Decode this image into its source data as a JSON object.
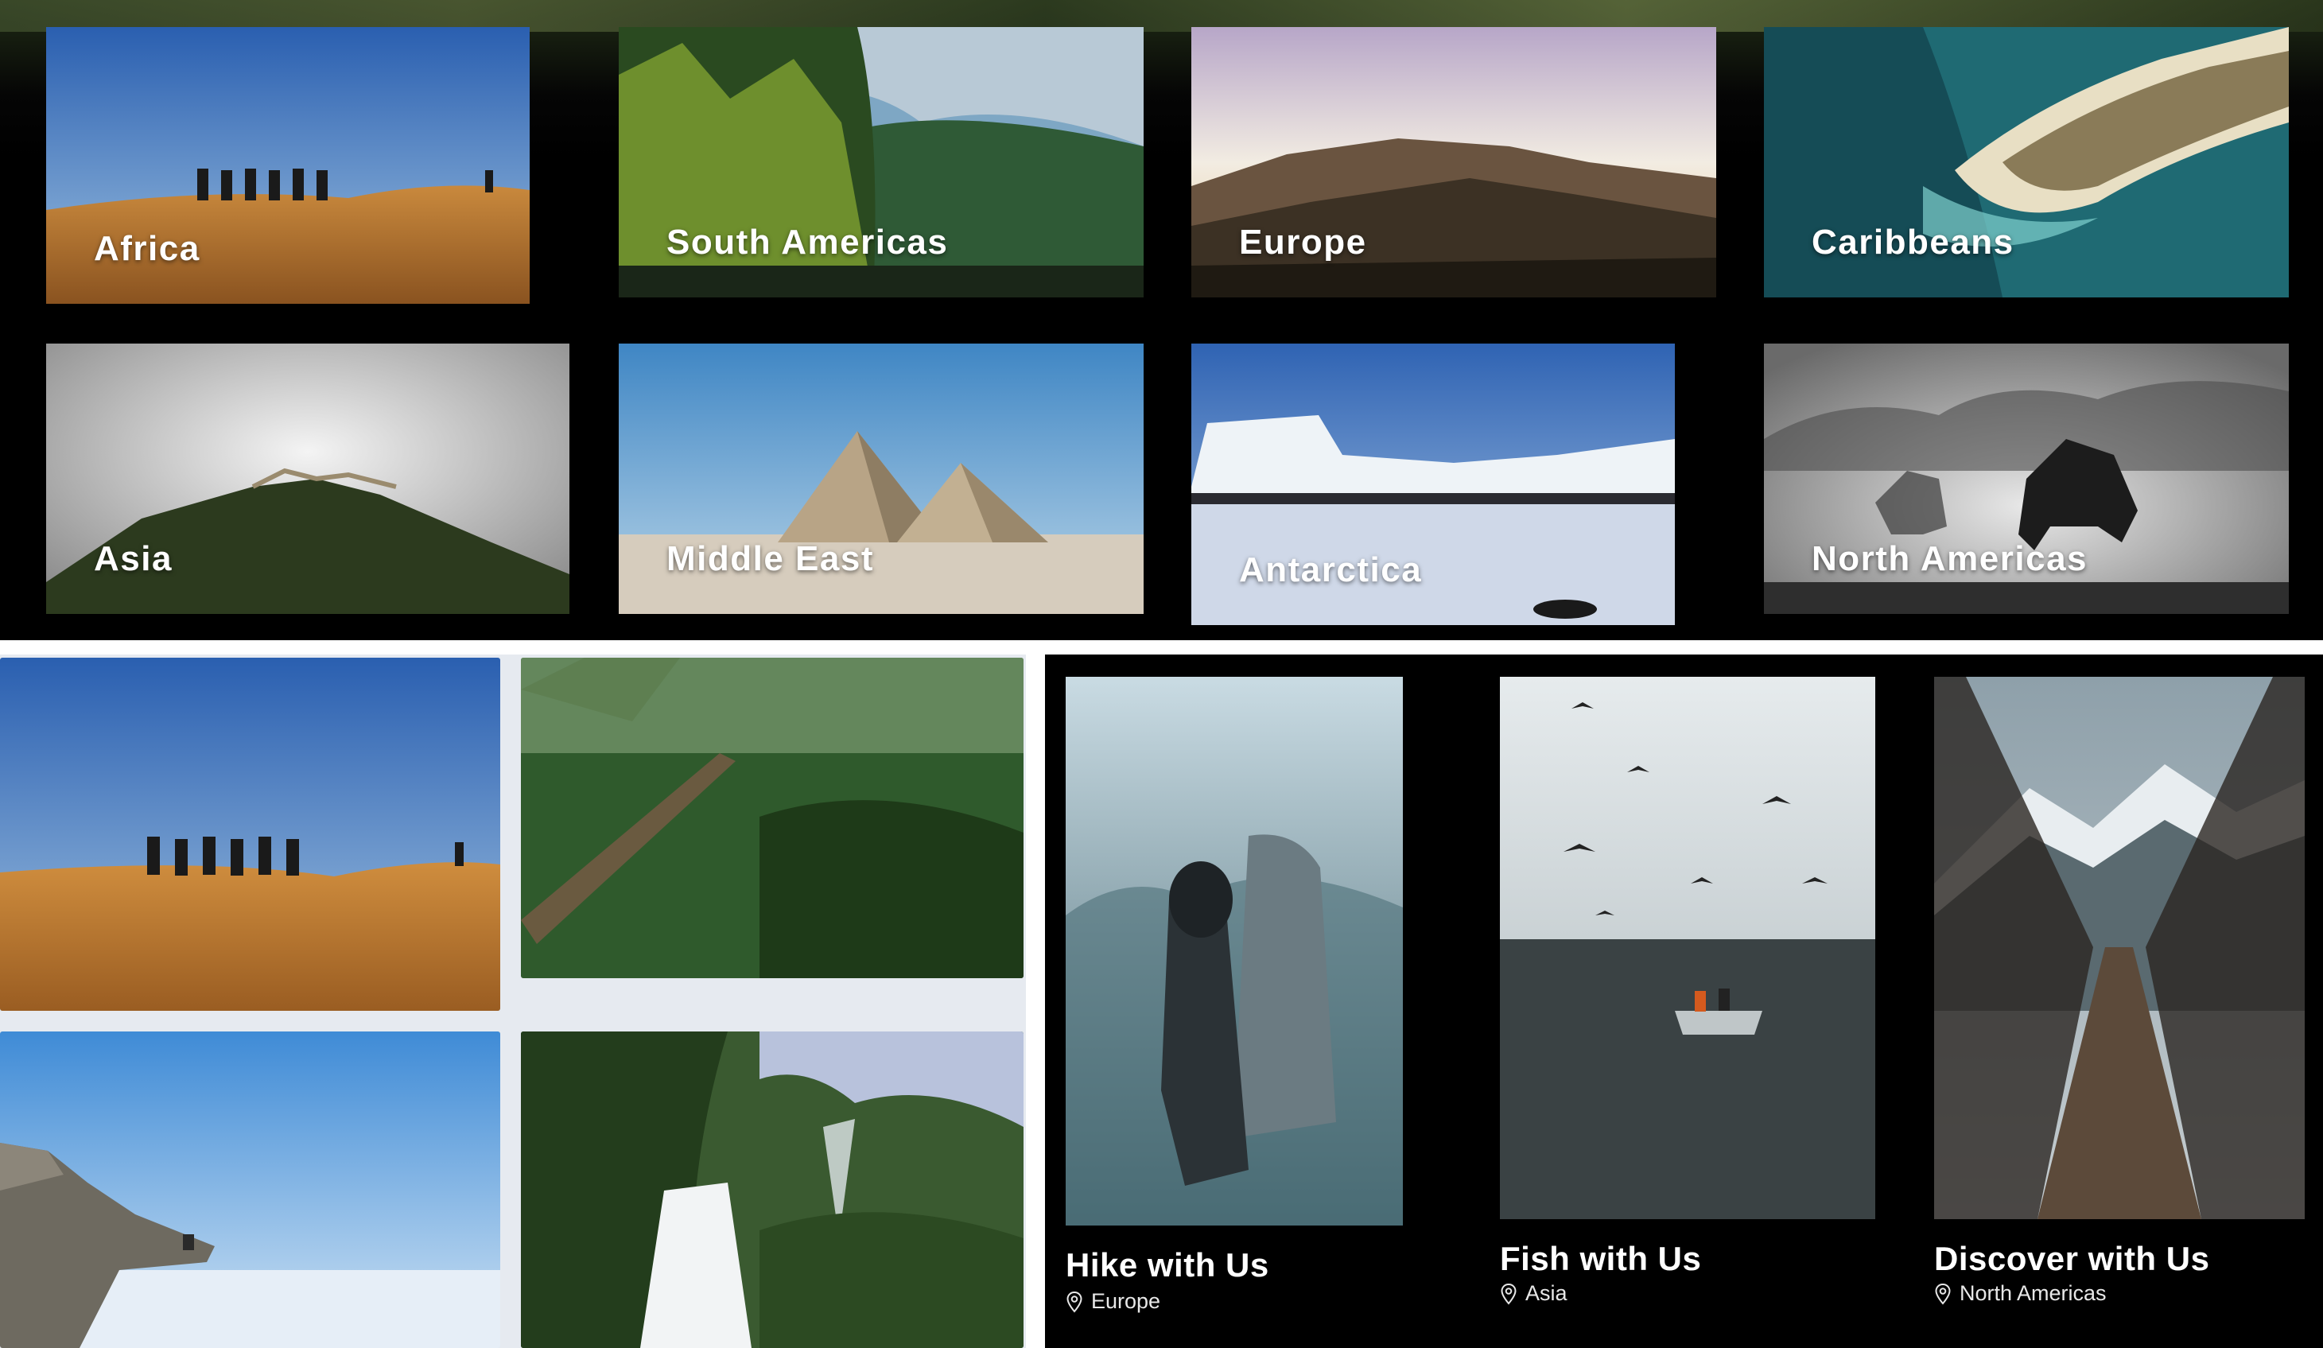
{
  "regions": [
    {
      "label": "Africa"
    },
    {
      "label": "South Americas"
    },
    {
      "label": "Europe"
    },
    {
      "label": "Caribbeans"
    },
    {
      "label": "Asia"
    },
    {
      "label": "Middle East"
    },
    {
      "label": "Antarctica"
    },
    {
      "label": "North Americas"
    }
  ],
  "activities": [
    {
      "title": "Hike with Us",
      "location": "Europe",
      "icon": "map-pin-icon"
    },
    {
      "title": "Fish with Us",
      "location": "Asia",
      "icon": "map-pin-icon"
    },
    {
      "title": "Discover with Us",
      "location": "North Americas",
      "icon": "map-pin-icon"
    }
  ],
  "colors": {
    "background": "#000000",
    "gallery_background": "#e6eaf0",
    "text": "#ffffff"
  }
}
